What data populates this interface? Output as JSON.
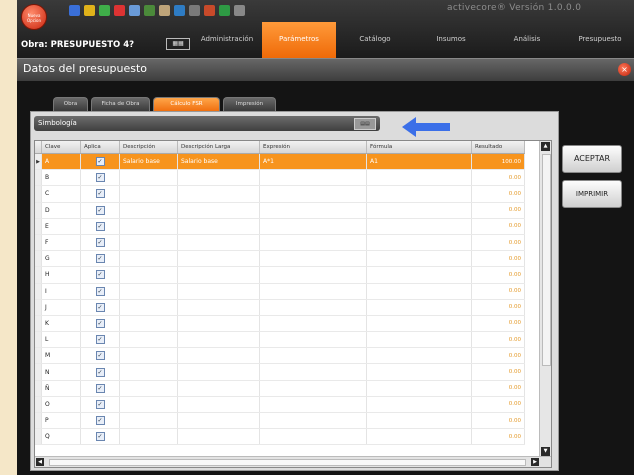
{
  "app": {
    "logo_text": "Nueva Opcion",
    "version": "activecore®  Versión  1.0.0.0"
  },
  "obra": {
    "label": "Obra: PRESUPUESTO 4?"
  },
  "menu": [
    {
      "label": "Administración"
    },
    {
      "label": "Parámetros"
    },
    {
      "label": "Catálogo"
    },
    {
      "label": "Insumos"
    },
    {
      "label": "Análisis"
    },
    {
      "label": "Presupuesto"
    }
  ],
  "window": {
    "title": "Datos del presupuesto"
  },
  "tabs": [
    {
      "label": "Obra"
    },
    {
      "label": "Ficha de Obra"
    },
    {
      "label": "Cálculo FSR"
    },
    {
      "label": "Impresión"
    }
  ],
  "section": {
    "title": "Simbología"
  },
  "columns": [
    "Clave",
    "Aplica",
    "Descripción",
    "Descripción Larga",
    "Expresión",
    "Fórmula",
    "Resultado"
  ],
  "rows": [
    {
      "clave": "A",
      "aplica": true,
      "descripcion": "Salario base",
      "descripcion_larga": "Salario base",
      "expresion": "A*1",
      "formula": "A1",
      "resultado": "100.00"
    },
    {
      "clave": "B",
      "aplica": true,
      "resultado": "0.00"
    },
    {
      "clave": "C",
      "aplica": true,
      "resultado": "0.00"
    },
    {
      "clave": "D",
      "aplica": true,
      "resultado": "0.00"
    },
    {
      "clave": "E",
      "aplica": true,
      "resultado": "0.00"
    },
    {
      "clave": "F",
      "aplica": true,
      "resultado": "0.00"
    },
    {
      "clave": "G",
      "aplica": true,
      "resultado": "0.00"
    },
    {
      "clave": "H",
      "aplica": true,
      "resultado": "0.00"
    },
    {
      "clave": "I",
      "aplica": true,
      "resultado": "0.00"
    },
    {
      "clave": "J",
      "aplica": true,
      "resultado": "0.00"
    },
    {
      "clave": "K",
      "aplica": true,
      "resultado": "0.00"
    },
    {
      "clave": "L",
      "aplica": true,
      "resultado": "0.00"
    },
    {
      "clave": "M",
      "aplica": true,
      "resultado": "0.00"
    },
    {
      "clave": "N",
      "aplica": true,
      "resultado": "0.00"
    },
    {
      "clave": "Ñ",
      "aplica": true,
      "resultado": "0.00"
    },
    {
      "clave": "O",
      "aplica": true,
      "resultado": "0.00"
    },
    {
      "clave": "P",
      "aplica": true,
      "resultado": "0.00"
    },
    {
      "clave": "Q",
      "aplica": true,
      "resultado": "0.00"
    }
  ],
  "buttons": {
    "accept": "ACEPTAR",
    "print": "IMPRIMIR"
  },
  "colors": {
    "accent": "#f7941d",
    "arrow": "#3b6fe8"
  }
}
